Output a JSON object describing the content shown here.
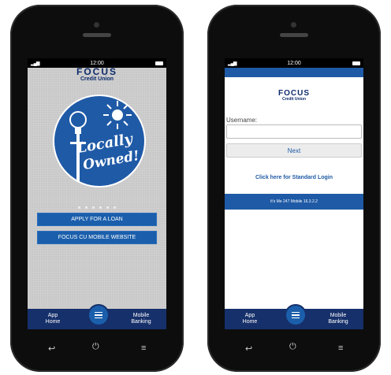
{
  "status": {
    "time": "12:00"
  },
  "left": {
    "logo_line1": "FOCUS",
    "logo_line2": "Credit Union",
    "badge_line1": "Locally",
    "badge_line2": "Owned!",
    "apply_label": "APPLY FOR A LOAN",
    "website_label": "FOCUS CU MOBILE WEBSITE"
  },
  "right": {
    "logo_line1": "FOCUS",
    "logo_line2": "Credit Union",
    "username_label": "Username:",
    "username_value": "",
    "next_label": "Next",
    "standard_login_label": "Click here for Standard Login",
    "version_text": "It's Me 247 Mobile 16.3.2.2"
  },
  "tabbar": {
    "home_line1": "App",
    "home_line2": "Home",
    "banking_line1": "Mobile",
    "banking_line2": "Banking"
  },
  "colors": {
    "primary": "#1f5aa6",
    "navy": "#16306b"
  }
}
